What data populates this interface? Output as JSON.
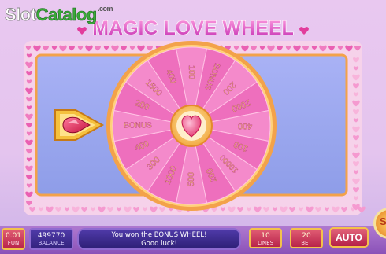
{
  "watermark": {
    "part1": "Slot",
    "part2": "Catalog",
    "domain": ".com"
  },
  "title": "MAGIC LOVE WHEEL",
  "wheel": {
    "segments": [
      "100",
      "BONUS",
      "200",
      "2000",
      "400",
      "100",
      "10000",
      "200",
      "500",
      "1000",
      "300",
      "400",
      "BONUS",
      "200",
      "1500",
      "400"
    ]
  },
  "bottom_bar": {
    "coin_value": "0.01",
    "coin_label": "FUN",
    "balance_value": "499770",
    "balance_label": "BALANCE",
    "message_line1": "You won the BONUS WHEEL!",
    "message_line2": "Good luck!",
    "lines_value": "10",
    "lines_label": "LINES",
    "bet_value": "20",
    "bet_label": "BET",
    "auto_label": "AUTO",
    "spin_label": "S"
  },
  "colors": {
    "wheel_pink": "#f07fc6",
    "wheel_rim": "#f3a24a",
    "panel_blue": "#9aa7f0",
    "gem_red": "#e8275a"
  }
}
